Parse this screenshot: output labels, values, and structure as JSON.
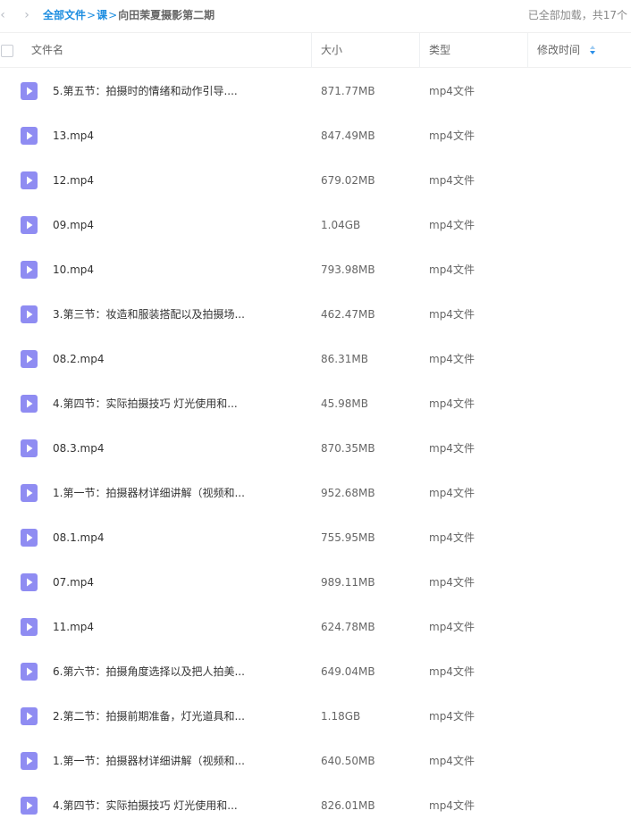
{
  "toolbar": {
    "back_icon": "chevron-left-icon",
    "forward_icon": "chevron-right-icon",
    "breadcrumb": {
      "root": "全部文件",
      "sep1": ">",
      "level1": "课",
      "sep2": ">",
      "current": "向田茉夏摄影第二期"
    },
    "load_status": "已全部加载，共17个"
  },
  "table": {
    "columns": {
      "name": "文件名",
      "size": "大小",
      "type": "类型",
      "modified": "修改时间"
    },
    "sort_icon": "sort-arrows-icon",
    "rows": [
      {
        "name": "5.第五节：拍摄时的情绪和动作引导....",
        "size": "871.77MB",
        "type": "mp4文件"
      },
      {
        "name": "13.mp4",
        "size": "847.49MB",
        "type": "mp4文件"
      },
      {
        "name": "12.mp4",
        "size": "679.02MB",
        "type": "mp4文件"
      },
      {
        "name": "09.mp4",
        "size": "1.04GB",
        "type": "mp4文件"
      },
      {
        "name": "10.mp4",
        "size": "793.98MB",
        "type": "mp4文件"
      },
      {
        "name": "3.第三节：妆造和服装搭配以及拍摄场...",
        "size": "462.47MB",
        "type": "mp4文件"
      },
      {
        "name": "08.2.mp4",
        "size": "86.31MB",
        "type": "mp4文件"
      },
      {
        "name": "4.第四节：实际拍摄技巧 灯光使用和...",
        "size": "45.98MB",
        "type": "mp4文件"
      },
      {
        "name": "08.3.mp4",
        "size": "870.35MB",
        "type": "mp4文件"
      },
      {
        "name": "1.第一节：拍摄器材详细讲解（视频和...",
        "size": "952.68MB",
        "type": "mp4文件"
      },
      {
        "name": "08.1.mp4",
        "size": "755.95MB",
        "type": "mp4文件"
      },
      {
        "name": "07.mp4",
        "size": "989.11MB",
        "type": "mp4文件"
      },
      {
        "name": "11.mp4",
        "size": "624.78MB",
        "type": "mp4文件"
      },
      {
        "name": "6.第六节：拍摄角度选择以及把人拍美...",
        "size": "649.04MB",
        "type": "mp4文件"
      },
      {
        "name": "2.第二节：拍摄前期准备，灯光道具和...",
        "size": "1.18GB",
        "type": "mp4文件"
      },
      {
        "name": "1.第一节：拍摄器材详细讲解（视频和...",
        "size": "640.50MB",
        "type": "mp4文件"
      },
      {
        "name": "4.第四节：实际拍摄技巧 灯光使用和...",
        "size": "826.01MB",
        "type": "mp4文件"
      }
    ]
  },
  "colors": {
    "link": "#1c8de0",
    "video_icon": "#8f8cf2",
    "sort_icon": "#2b8fe8"
  }
}
